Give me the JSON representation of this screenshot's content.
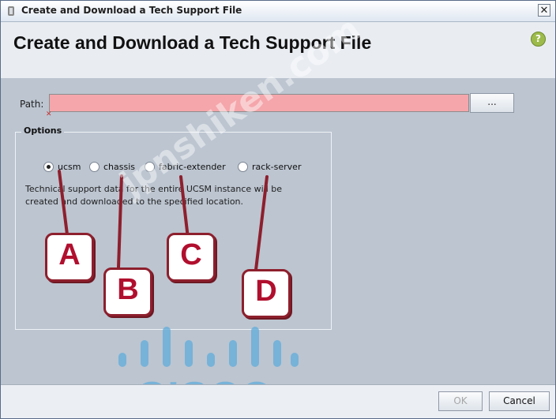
{
  "window": {
    "title": "Create and Download a Tech Support File",
    "close_label": "✕",
    "close_icon": "close-icon",
    "title_icon": "app-icon"
  },
  "header": {
    "title": "Create and Download a Tech Support File",
    "help_symbol": "?",
    "help_icon": "help-icon"
  },
  "form": {
    "path_label": "Path:",
    "path_value": "",
    "browse_label": "...",
    "path_error_icon": "error-icon",
    "path_error_color": "#f5a6ab"
  },
  "options": {
    "label": "Options",
    "radios": [
      {
        "label": "ucsm",
        "selected": true
      },
      {
        "label": "chassis",
        "selected": false
      },
      {
        "label": "fabric-extender",
        "selected": false
      },
      {
        "label": "rack-server",
        "selected": false
      }
    ],
    "description": "Technical support data for the entire UCSM instance will be created and downloaded to the specified location."
  },
  "callouts": [
    {
      "letter": "A"
    },
    {
      "letter": "B"
    },
    {
      "letter": "C"
    },
    {
      "letter": "D"
    }
  ],
  "watermark": "jpnshiken.com",
  "logo": {
    "text": "CISCO",
    "color": "#66aedb"
  },
  "footer": {
    "ok_label": "OK",
    "cancel_label": "Cancel"
  }
}
